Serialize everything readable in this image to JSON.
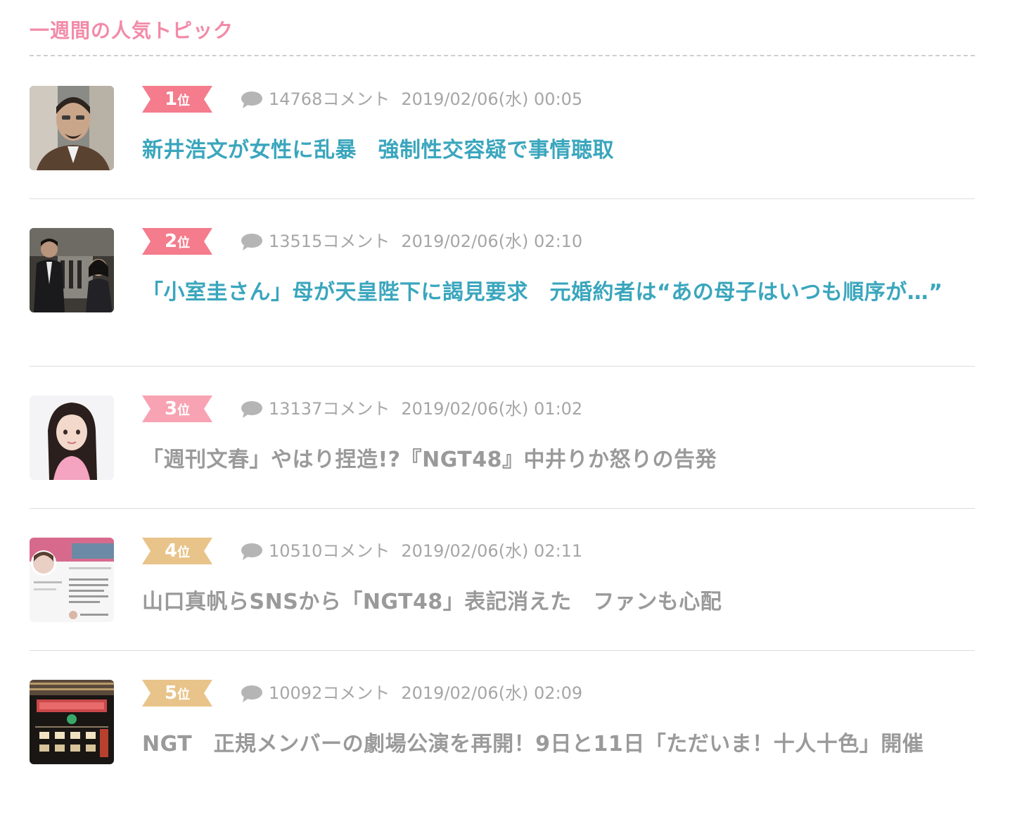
{
  "section": {
    "title": "一週間の人気トピック"
  },
  "colors": {
    "title_pink": "#f28ba8",
    "link_teal": "#3aa6bd",
    "text_gray": "#9a9a9a",
    "badge_top": "#f47c8c",
    "badge_mid": "#f7a3b3",
    "badge_low": "#e8c48a"
  },
  "topics": [
    {
      "rank": "1",
      "rank_suffix": "位",
      "comments": "14768コメント",
      "date": "2019/02/06(水) 00:05",
      "title": "新井浩文が女性に乱暴　強制性交容疑で事情聴取",
      "thumbnail": "man-with-glasses-photo",
      "badge_color": "#f47c8c",
      "title_style": "accent"
    },
    {
      "rank": "2",
      "rank_suffix": "位",
      "comments": "13515コメント",
      "date": "2019/02/06(水) 02:10",
      "title": "「小室圭さん」母が天皇陛下に謁見要求　元婚約者は“あの母子はいつも順序が…”",
      "thumbnail": "street-couple-photo",
      "badge_color": "#f47c8c",
      "title_style": "accent"
    },
    {
      "rank": "3",
      "rank_suffix": "位",
      "comments": "13137コメント",
      "date": "2019/02/06(水) 01:02",
      "title": "「週刊文春」やはり捏造!?『NGT48』中井りか怒りの告発",
      "thumbnail": "idol-portrait-photo",
      "badge_color": "#f7a3b3",
      "title_style": "muted"
    },
    {
      "rank": "4",
      "rank_suffix": "位",
      "comments": "10510コメント",
      "date": "2019/02/06(水) 02:11",
      "title": "山口真帆らSNSから「NGT48」表記消えた　ファンも心配",
      "thumbnail": "twitter-profile-screenshot",
      "badge_color": "#e8c48a",
      "title_style": "muted"
    },
    {
      "rank": "5",
      "rank_suffix": "位",
      "comments": "10092コメント",
      "date": "2019/02/06(水) 02:09",
      "title": "NGT　正規メンバーの劇場公演を再開！9日と11日「ただいま！十人十色」開催",
      "thumbnail": "theater-building-photo",
      "badge_color": "#e8c48a",
      "title_style": "muted"
    }
  ]
}
